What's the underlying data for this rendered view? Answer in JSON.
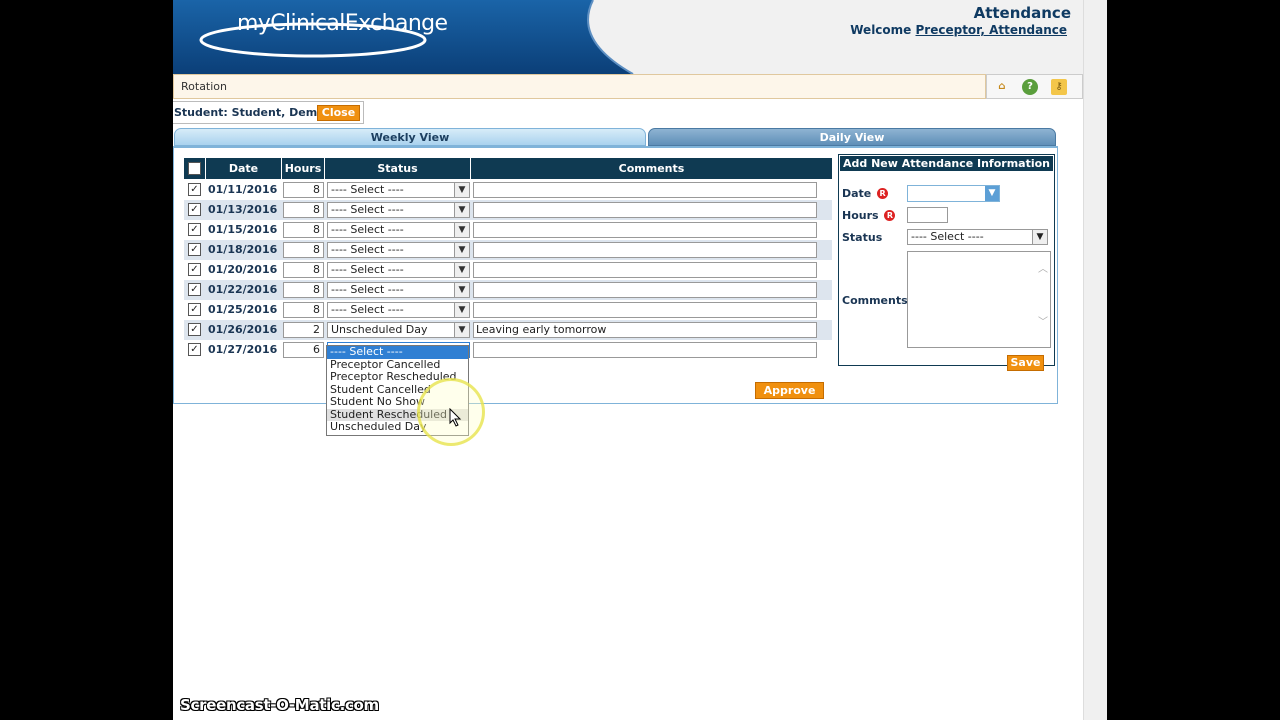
{
  "header": {
    "logo": "myClinicalExchange",
    "page_title": "Attendance",
    "welcome_label": "Welcome",
    "welcome_user": "Preceptor, Attendance"
  },
  "breadcrumb": {
    "text": "Rotation"
  },
  "toolbar": {
    "icons": [
      "home-icon",
      "help-icon",
      "key-icon"
    ]
  },
  "student": {
    "label": "Student: Student, Demo",
    "close_label": "Close"
  },
  "tabs": {
    "weekly": "Weekly View",
    "daily": "Daily View",
    "active": "weekly"
  },
  "table": {
    "headers": {
      "date": "Date",
      "hours": "Hours",
      "status": "Status",
      "comments": "Comments"
    },
    "rows": [
      {
        "checked": true,
        "date": "01/11/2016",
        "hours": "8",
        "status": "---- Select ----",
        "comment": ""
      },
      {
        "checked": true,
        "date": "01/13/2016",
        "hours": "8",
        "status": "---- Select ----",
        "comment": ""
      },
      {
        "checked": true,
        "date": "01/15/2016",
        "hours": "8",
        "status": "---- Select ----",
        "comment": ""
      },
      {
        "checked": true,
        "date": "01/18/2016",
        "hours": "8",
        "status": "---- Select ----",
        "comment": ""
      },
      {
        "checked": true,
        "date": "01/20/2016",
        "hours": "8",
        "status": "---- Select ----",
        "comment": ""
      },
      {
        "checked": true,
        "date": "01/22/2016",
        "hours": "8",
        "status": "---- Select ----",
        "comment": ""
      },
      {
        "checked": true,
        "date": "01/25/2016",
        "hours": "8",
        "status": "---- Select ----",
        "comment": ""
      },
      {
        "checked": true,
        "date": "01/26/2016",
        "hours": "2",
        "status": "Unscheduled Day",
        "comment": "Leaving early tomorrow"
      },
      {
        "checked": true,
        "date": "01/27/2016",
        "hours": "6",
        "status": "---- Select ----",
        "comment": ""
      }
    ],
    "approve_label": "Approve"
  },
  "status_dropdown": {
    "open_for_row": 8,
    "options": [
      "---- Select ----",
      "Preceptor Cancelled",
      "Preceptor Rescheduled",
      "Student Cancelled",
      "Student No Show",
      "Student Rescheduled",
      "Unscheduled Day"
    ],
    "selected_index": 0,
    "hover_index": 5
  },
  "add_new": {
    "title": "Add New Attendance Information",
    "date_label": "Date",
    "hours_label": "Hours",
    "status_label": "Status",
    "status_value": "---- Select ----",
    "comments_label": "Comments",
    "required_mark": "R",
    "save_label": "Save"
  },
  "watermark": "Screencast-O-Matic.com",
  "colors": {
    "header_blue": "#0f4c8a",
    "table_header": "#0f3a52",
    "accent_orange": "#f0900f",
    "row_alt": "#dde5ee"
  }
}
